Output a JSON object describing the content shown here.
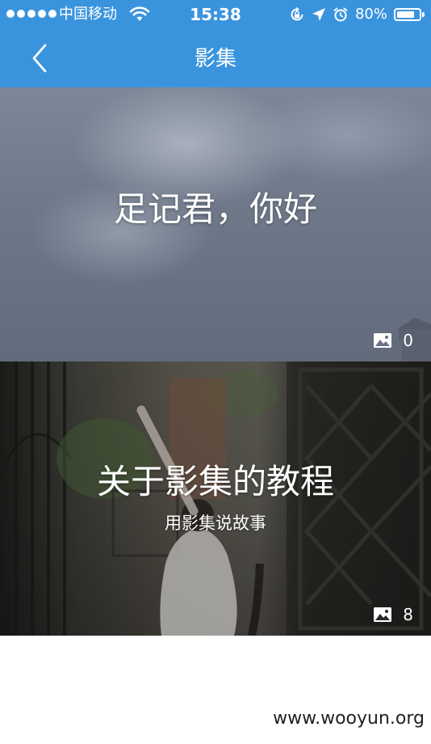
{
  "status_bar": {
    "carrier": "中国移动",
    "time": "15:38",
    "battery_percent": "80%",
    "battery_level": 0.8,
    "signal_bars": 5,
    "icons": [
      "signal-dots-icon",
      "wifi-icon",
      "rotation-lock-icon",
      "location-arrow-icon",
      "alarm-clock-icon",
      "battery-icon"
    ]
  },
  "nav": {
    "back_icon": "chevron-left-icon",
    "title": "影集"
  },
  "albums": [
    {
      "title": "足记君，你好",
      "subtitle": "",
      "photo_count": "0",
      "count_icon": "image-icon"
    },
    {
      "title": "关于影集的教程",
      "subtitle": "用影集说故事",
      "photo_count": "8",
      "count_icon": "image-icon"
    }
  ],
  "watermark": "www.wooyun.org",
  "colors": {
    "header_blue": "#3a94dd",
    "text_on_header": "#ffffff",
    "page_background": "#ffffff"
  }
}
